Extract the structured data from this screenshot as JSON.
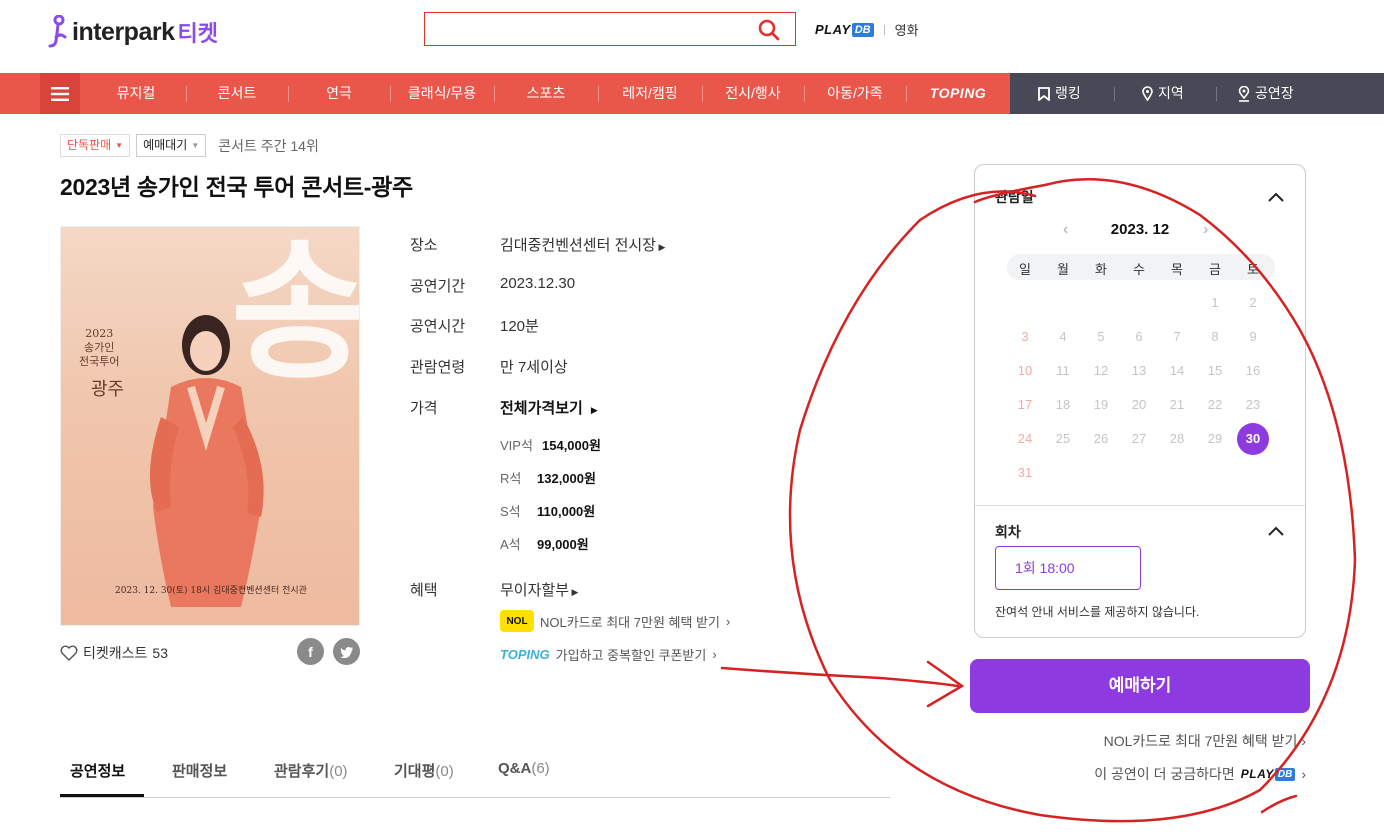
{
  "header": {
    "logo_word": "interpark",
    "logo_ticket": "티켓",
    "search_placeholder": "",
    "playdb_text": "PLAY",
    "playdb_db": "DB",
    "movie_link": "영화"
  },
  "nav": {
    "items": [
      "뮤지컬",
      "콘서트",
      "연극",
      "클래식/무용",
      "스포츠",
      "레저/캠핑",
      "전시/행사",
      "아동/가족",
      "TOPING"
    ],
    "right_items": [
      "랭킹",
      "지역",
      "공연장"
    ]
  },
  "tags": {
    "exclusive": "단독판매",
    "waiting": "예매대기",
    "rank": "콘서트 주간 14위"
  },
  "title": "2023년 송가인 전국 투어 콘서트-광주",
  "poster": {
    "big_glyph": "송",
    "year_lines": "2023 송가인 전국투어",
    "year": "2023",
    "artist": "송가인",
    "tour": "전국투어",
    "city": "광주",
    "bottom": "2023. 12. 30(토) 18시  김대중컨벤션센터 전시관"
  },
  "ticketcast": {
    "label": "티켓캐스트",
    "count": "53"
  },
  "info": {
    "venue_label": "장소",
    "venue_value": "김대중컨벤션센터 전시장",
    "period_label": "공연기간",
    "period_value": "2023.12.30",
    "runtime_label": "공연시간",
    "runtime_value": "120분",
    "age_label": "관람연령",
    "age_value": "만 7세이상",
    "price_label": "가격",
    "price_all": "전체가격보기",
    "prices": [
      {
        "grade": "VIP석",
        "amount": "154,000원"
      },
      {
        "grade": "R석",
        "amount": "132,000원"
      },
      {
        "grade": "S석",
        "amount": "110,000원"
      },
      {
        "grade": "A석",
        "amount": "99,000원"
      }
    ],
    "benefit_label": "혜택",
    "benefit_value": "무이자할부",
    "nol_badge": "NOL",
    "nol_text": "NOL카드로 최대 7만원 혜택 받기",
    "toping_badge": "TOPING",
    "toping_text": "가입하고 중복할인 쿠폰받기"
  },
  "tabs": [
    {
      "label": "공연정보",
      "count": ""
    },
    {
      "label": "판매정보",
      "count": ""
    },
    {
      "label": "관람후기",
      "count": "(0)"
    },
    {
      "label": "기대평",
      "count": "(0)"
    },
    {
      "label": "Q&A",
      "count": "(6)"
    }
  ],
  "panel": {
    "date_title": "관람일",
    "month": "2023. 12",
    "dows": [
      "일",
      "월",
      "화",
      "수",
      "목",
      "금",
      "토"
    ],
    "selected_day": "30",
    "session_title": "회차",
    "session_btn": "1회  18:00",
    "seat_note": "잔여석 안내 서비스를 제공하지 않습니다."
  },
  "book_button": "예매하기",
  "nol_right": "NOL카드로 최대 7만원 혜택 받기",
  "playdb_right_prefix": "이 공연이 더 궁금하다면",
  "colors": {
    "nav_red": "#e9574b",
    "nav_dark": "#474a56",
    "accent_purple": "#8d3be0",
    "annotation_red": "#d62222"
  },
  "icons": [
    "search-icon",
    "hamburger-icon",
    "bookmark-icon",
    "location-pin-icon",
    "heart-icon",
    "facebook-icon",
    "twitter-icon",
    "chevron-up-icon",
    "chevron-left-icon",
    "chevron-right-icon"
  ]
}
